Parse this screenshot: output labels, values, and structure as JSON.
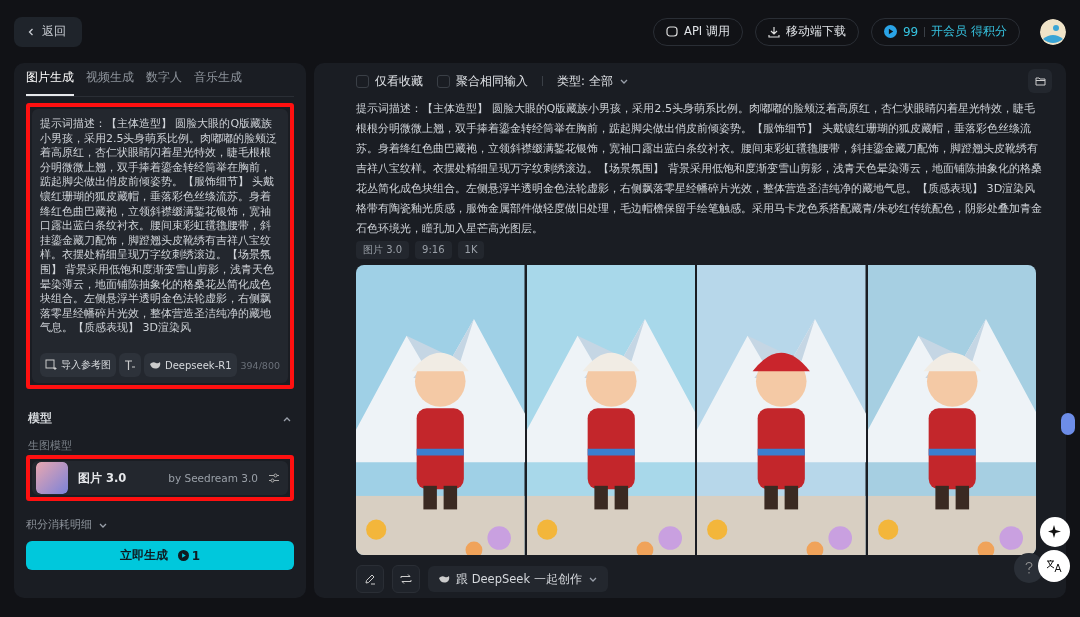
{
  "back_button": {
    "label": "返回"
  },
  "header": {
    "api_button": "API 调用",
    "download_button": "移动端下载",
    "points": "99",
    "membership_link": "开会员 得积分"
  },
  "left_panel": {
    "tabs": [
      {
        "label": "图片生成",
        "selected": true
      },
      {
        "label": "视频生成",
        "selected": false
      },
      {
        "label": "数字人",
        "selected": false
      },
      {
        "label": "音乐生成",
        "selected": false
      }
    ],
    "prompt": {
      "value": "提示词描述：【主体造型】 圆脸大眼的Q版藏族小男孩，采用2.5头身萌系比例。肉嘟嘟的脸颊泛着高原红，杏仁状眼睛闪着星光特效，睫毛根根分明微微上翘，双手捧着鎏金转经筒举在胸前，踮起脚尖做出俏皮前倾姿势。【服饰细节】 头戴镶红珊瑚的狐皮藏帽，垂落彩色丝绦流苏。身着绛红色曲巴藏袍，立领斜襟缀满錾花银饰，宽袖口露出蓝白条纹衬衣。腰间束彩虹氆氇腰带，斜挂鎏金藏刀配饰，脚蹬翘头皮靴绣有吉祥八宝纹样。衣摆处精细呈现万字纹刺绣滚边。【场景氛围】 背景采用低饱和度渐变雪山剪影，浅青天色晕染薄云，地面铺陈抽象化的格桑花丛简化成色块组合。左侧悬浮半透明金色法轮虚影，右侧飘落零星经幡碎片光效，整体营造圣洁纯净的藏地气息。【质感表现】 3D渲染风",
      "highlighted": true,
      "import_button": "导入参考图",
      "model_chip": "Deepseek-R1",
      "counter": "394/800"
    },
    "model_section": {
      "title": "模型",
      "expanded": true,
      "subtitle": "生图模型",
      "model_card": {
        "name": "图片 3.0",
        "provider": "by Seedream 3.0",
        "highlighted": true
      }
    },
    "cost_detail": {
      "label": "积分消耗明细",
      "expanded": false
    },
    "generate_button": {
      "label": "立即生成",
      "cost": "1"
    }
  },
  "right_panel": {
    "filters": [
      {
        "label": "仅看收藏",
        "checked": false
      },
      {
        "label": "聚合相同输入",
        "checked": false
      }
    ],
    "type_filter": "类型: 全部",
    "result": {
      "prompt": "提示词描述：【主体造型】 圆脸大眼的Q版藏族小男孩，采用2.5头身萌系比例。肉嘟嘟的脸颊泛着高原红，杏仁状眼睛闪着星光特效，睫毛根根分明微微上翘，双手捧着鎏金转经筒举在胸前，踮起脚尖做出俏皮前倾姿势。【服饰细节】 头戴镶红珊瑚的狐皮藏帽，垂落彩色丝绦流苏。身着绛红色曲巴藏袍，立领斜襟缀满錾花银饰，宽袖口露出蓝白条纹衬衣。腰间束彩虹氆氇腰带，斜挂鎏金藏刀配饰，脚蹬翘头皮靴绣有吉祥八宝纹样。衣摆处精细呈现万字纹刺绣滚边。【场景氛围】 背景采用低饱和度渐变雪山剪影，浅青天色晕染薄云，地面铺陈抽象化的格桑花丛简化成色块组合。左侧悬浮半透明金色法轮虚影，右侧飘落零星经幡碎片光效，整体营造圣洁纯净的藏地气息。【质感表现】 3D渲染风格带有陶瓷釉光质感，服饰金属部件做轻度做旧处理，毛边帽檐保留手绘笔触感。采用马卡龙色系搭配藏青/朱砂红传统配色，阴影处叠加青金石色环境光，瞳孔加入星芒高光图层。",
      "tags": [
        "图片 3.0",
        "9:16",
        "1K"
      ],
      "images": [
        {
          "kind": "picture"
        },
        {
          "kind": "picture"
        },
        {
          "kind": "picture"
        },
        {
          "kind": "picture"
        }
      ],
      "deepseek_button": "跟 DeepSeek 一起创作"
    }
  }
}
